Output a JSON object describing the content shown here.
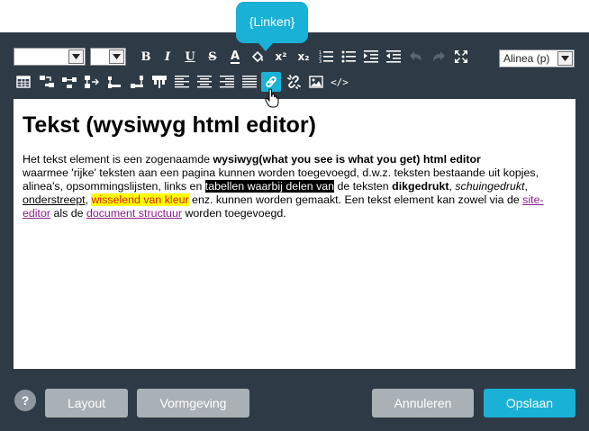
{
  "tooltip": {
    "text": "{Linken}"
  },
  "toolbar": {
    "font_select": {
      "value": ""
    },
    "size_select": {
      "value": ""
    },
    "format_select": {
      "value": "Alinea (p)"
    },
    "row1": [
      {
        "icon": "bold-icon",
        "label": "B"
      },
      {
        "icon": "italic-icon",
        "label": "I"
      },
      {
        "icon": "underline-icon",
        "label": "U"
      },
      {
        "icon": "strikethrough-icon",
        "label": "S"
      },
      {
        "icon": "text-color-icon",
        "label": "A"
      },
      {
        "icon": "paint-bucket-icon"
      },
      {
        "icon": "superscript-icon",
        "label": "x²"
      },
      {
        "icon": "subscript-icon",
        "label": "x₂"
      },
      {
        "icon": "numbered-list-icon"
      },
      {
        "icon": "bullet-list-icon"
      },
      {
        "icon": "indent-icon"
      },
      {
        "icon": "outdent-icon"
      },
      {
        "icon": "undo-icon"
      },
      {
        "icon": "redo-icon"
      },
      {
        "icon": "fullscreen-icon"
      }
    ],
    "row2": [
      {
        "icon": "table-icon"
      },
      {
        "icon": "insert-row-before-icon"
      },
      {
        "icon": "insert-row-after-icon"
      },
      {
        "icon": "insert-column-after-icon"
      },
      {
        "icon": "delete-row-icon"
      },
      {
        "icon": "delete-column-icon"
      },
      {
        "icon": "merge-cells-icon"
      },
      {
        "icon": "align-left-icon"
      },
      {
        "icon": "align-center-icon"
      },
      {
        "icon": "align-right-icon"
      },
      {
        "icon": "align-justify-icon"
      },
      {
        "icon": "link-icon"
      },
      {
        "icon": "unlink-icon"
      },
      {
        "icon": "image-icon"
      },
      {
        "icon": "source-code-icon",
        "label": "</>"
      }
    ]
  },
  "editor": {
    "heading": "Tekst (wysiwyg html editor)",
    "p1": "Het tekst element is een zogenaamde ",
    "p1_bold": "wysiwyg(what you see is what you get) html editor",
    "p2": "waarmee 'rijke' teksten aan een pagina kunnen worden toegevoegd, d.w.z. teksten bestaande uit kopjes, alinea's, opsommingslijsten, links en ",
    "p2_highlight": "tabellen waarbij delen van",
    "p3": " de teksten ",
    "p3_bold": "dikgedrukt",
    "p3_sep": ", ",
    "p3_italic": "schuingedrukt",
    "p3_end": ",",
    "underline": "onderstreept",
    "comma": ", ",
    "colored": "wisselend van kleur",
    "p4": " enz. kunnen worden gemaakt. Een tekst element kan zowel via de ",
    "link1": "site-editor",
    "p5": " als de ",
    "link2": "document structuur",
    "p6": " worden toegevoegd."
  },
  "footer": {
    "help": "?",
    "layout": "Layout",
    "vormgeving": "Vormgeving",
    "annuleren": "Annuleren",
    "opslaan": "Opslaan"
  },
  "colors": {
    "panel": "#2e3a45",
    "accent": "#1ab1d6",
    "secondary_button": "#a9b1b7"
  }
}
